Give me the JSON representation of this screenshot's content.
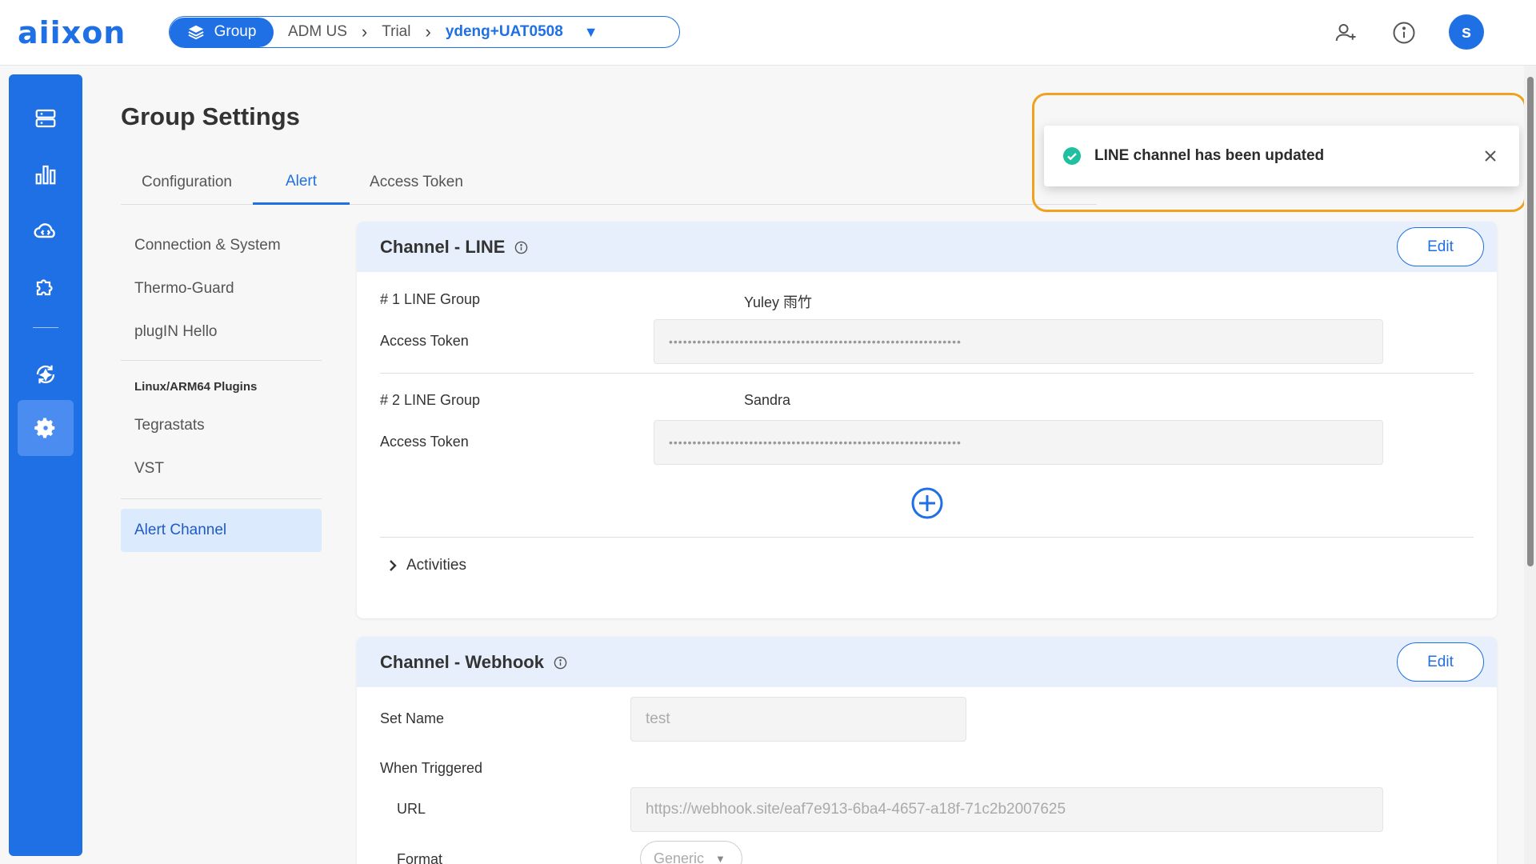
{
  "app": {
    "logo": "aiixon"
  },
  "breadcrumb": {
    "group_label": "Group",
    "items": [
      "ADM US",
      "Trial"
    ],
    "current": "ydeng+UAT0508"
  },
  "header_icons": [
    "add-user-icon",
    "info-icon"
  ],
  "user": {
    "initial": "s"
  },
  "rail": [
    "server-icon",
    "chart-icon",
    "cloud-sync-icon",
    "puzzle-icon",
    "deploy-icon",
    "gear-icon"
  ],
  "page": {
    "title": "Group Settings"
  },
  "tabs": [
    {
      "label": "Configuration",
      "active": false
    },
    {
      "label": "Alert",
      "active": true
    },
    {
      "label": "Access Token",
      "active": false
    }
  ],
  "sidemenu": {
    "items_a": [
      "Connection & System",
      "Thermo-Guard",
      "plugIN Hello"
    ],
    "heading": "Linux/ARM64 Plugins",
    "items_b": [
      "Tegrastats",
      "VST"
    ],
    "active_item": "Alert Channel"
  },
  "line_card": {
    "title": "Channel - LINE",
    "edit_label": "Edit",
    "groups": [
      {
        "label": "# 1 LINE Group",
        "name": "Yuley 雨竹",
        "token_label": "Access Token",
        "token_mask": "••••••••••••••••••••••••••••••••••••••••••••••••••••••••••••••"
      },
      {
        "label": "# 2 LINE Group",
        "name": "Sandra",
        "token_label": "Access Token",
        "token_mask": "••••••••••••••••••••••••••••••••••••••••••••••••••••••••••••••"
      }
    ],
    "activities_label": "Activities"
  },
  "webhook_card": {
    "title": "Channel - Webhook",
    "edit_label": "Edit",
    "set_name_label": "Set Name",
    "set_name_value": "test",
    "when_triggered_label": "When Triggered",
    "url_label": "URL",
    "url_value": "https://webhook.site/eaf7e913-6ba4-4657-a18f-71c2b2007625",
    "format_label": "Format",
    "format_value": "Generic"
  },
  "toast": {
    "message": "LINE channel has been updated"
  },
  "colors": {
    "primary": "#1f6fe5",
    "toast_highlight": "#f0a21e",
    "success": "#1fbf9f"
  }
}
